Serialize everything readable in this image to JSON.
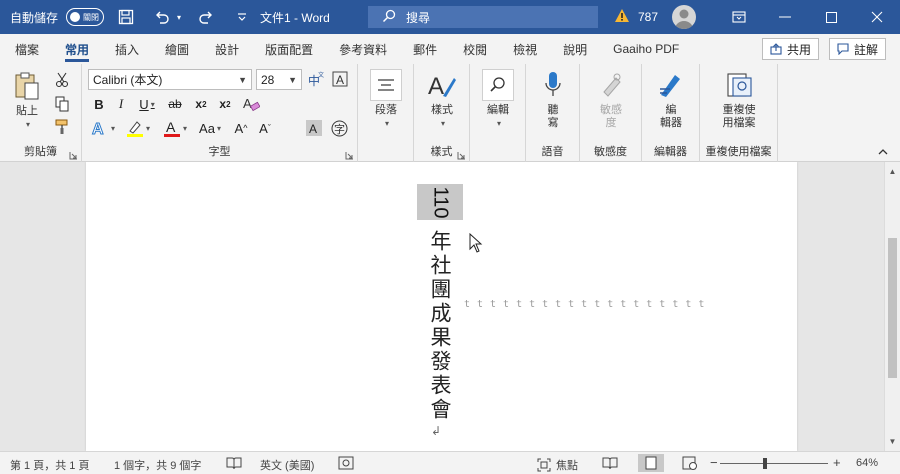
{
  "titlebar": {
    "autosave_label": "自動儲存",
    "autosave_state": "關閉",
    "doc_title": "文件1 - Word",
    "search_placeholder": "搜尋",
    "warning_count": "787",
    "accent_color": "#2b579a"
  },
  "tabs": [
    {
      "label": "檔案"
    },
    {
      "label": "常用",
      "active": true
    },
    {
      "label": "插入"
    },
    {
      "label": "繪圖"
    },
    {
      "label": "設計"
    },
    {
      "label": "版面配置"
    },
    {
      "label": "參考資料"
    },
    {
      "label": "郵件"
    },
    {
      "label": "校閱"
    },
    {
      "label": "檢視"
    },
    {
      "label": "說明"
    },
    {
      "label": "Gaaiho PDF"
    }
  ],
  "tab_actions": {
    "share": "共用",
    "comments": "註解"
  },
  "ribbon": {
    "clipboard": {
      "paste": "貼上",
      "label": "剪貼簿"
    },
    "font": {
      "name": "Calibri (本文)",
      "size": "28",
      "label": "字型"
    },
    "paragraph": {
      "button": "段落"
    },
    "styles": {
      "button": "樣式",
      "label": "樣式"
    },
    "editing": {
      "button": "編輯"
    },
    "voice": {
      "button_line1": "聽",
      "button_line2": "寫",
      "label": "語音"
    },
    "sensitivity": {
      "button_line1": "敏感",
      "button_line2": "度",
      "label": "敏感度"
    },
    "editor": {
      "button_line1": "編",
      "button_line2": "輯器",
      "label": "編輯器"
    },
    "reuse": {
      "button_line1": "重複使",
      "button_line2": "用檔案",
      "label": "重複使用檔案"
    }
  },
  "document": {
    "number": "110",
    "text": "年社團成果發表會",
    "tab_marks": "ttttttttttttttttttt"
  },
  "statusbar": {
    "page": "第 1 頁，共 1 頁",
    "words": "1 個字，共 9 個字",
    "language": "英文 (美國)",
    "focus": "焦點",
    "zoom": "64%",
    "zoom_minus": "−",
    "zoom_plus": "+",
    "zoom_level": 0.42
  }
}
